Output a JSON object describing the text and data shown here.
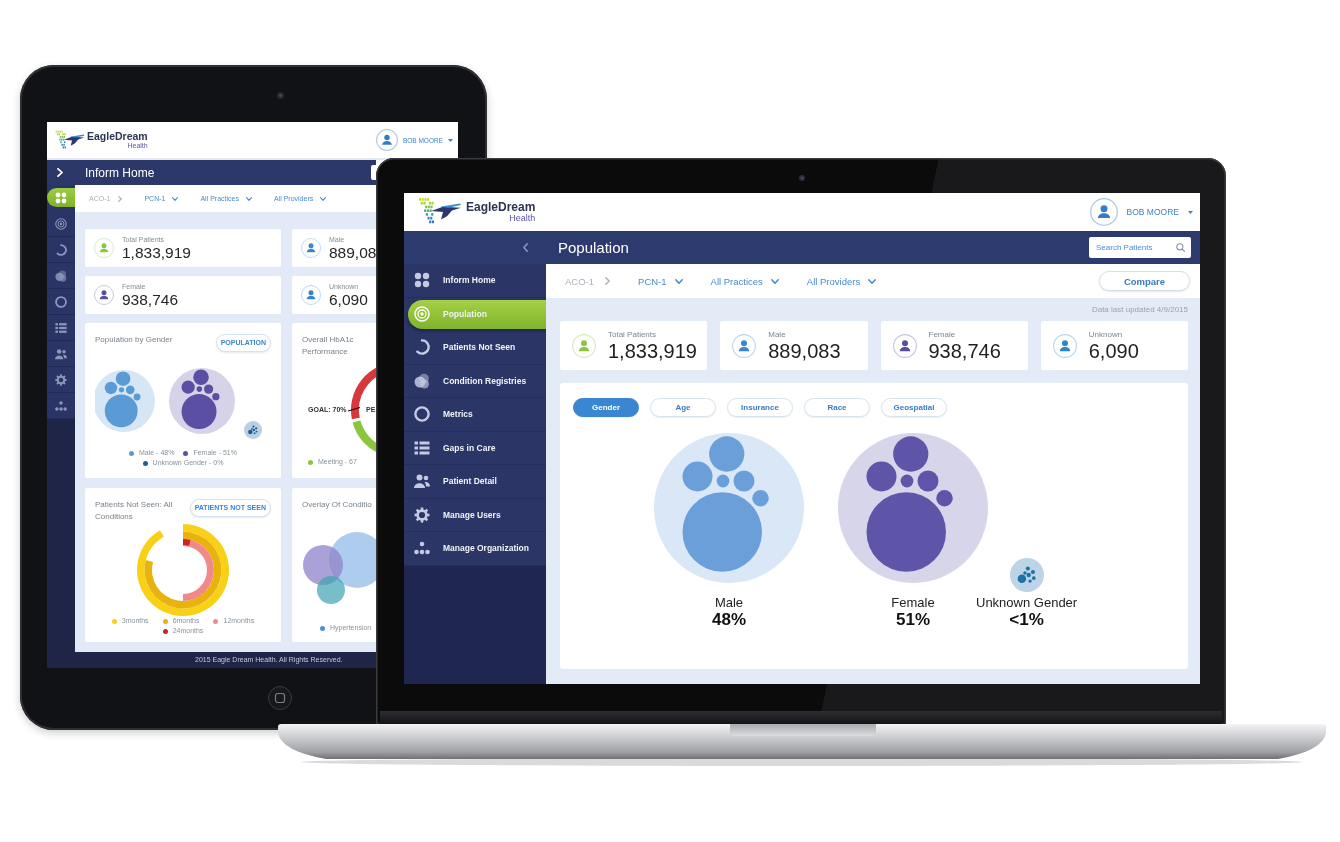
{
  "tablet": {
    "header": {
      "brand": "EagleDream",
      "brand_sub": "Health",
      "user": "BOB MOORE"
    },
    "title_bar": {
      "title": "Inform Home"
    },
    "rail": [
      {
        "selected": true
      },
      {
        "selected": false
      },
      {
        "selected": false
      },
      {
        "selected": false
      },
      {
        "selected": false
      },
      {
        "selected": false
      },
      {
        "selected": false
      },
      {
        "selected": false
      },
      {
        "selected": false
      }
    ],
    "breadcrumb": {
      "root": "ACO-1",
      "filters": [
        "PCN-1",
        "All Practices",
        "All Providers"
      ]
    },
    "stats": [
      {
        "label": "Total Patients",
        "value": "1,833,919",
        "color": "#8cc63f"
      },
      {
        "label": "Male",
        "value": "889,08",
        "color": "#3a86d0"
      },
      {
        "label": "Female",
        "value": "938,746",
        "color": "#5a4fa3"
      },
      {
        "label": "Unknown",
        "value": "6,090",
        "color": "#2f86c9"
      }
    ],
    "cards": [
      {
        "kind": "gender",
        "title": "Population by Gender",
        "button": "POPULATION",
        "legend": [
          {
            "label": "Male - 48%",
            "color": "#5b9bd5"
          },
          {
            "label": "Female - 51%",
            "color": "#5a4fa3"
          },
          {
            "label": "Unknown Gender - 0%",
            "color": "#1d5f96"
          }
        ]
      },
      {
        "kind": "gauge",
        "title": "Overall HbA1c Performance",
        "goal_label": "GOAL: 70%",
        "side_label": "PE",
        "legend": [
          {
            "label": "Meeting - 67",
            "color": "#8cc63f"
          }
        ]
      },
      {
        "kind": "radial",
        "title": "Patients Not Seen: All Conditions",
        "button": "PATIENTS NOT SEEN",
        "legend": [
          {
            "label": "3months",
            "color": "#f8d117"
          },
          {
            "label": "6months",
            "color": "#e8b30c"
          },
          {
            "label": "12months",
            "color": "#f08a8a"
          },
          {
            "label": "24months",
            "color": "#c62828"
          }
        ]
      },
      {
        "kind": "venn",
        "title": "Overlay Of Conditio",
        "legend": [
          {
            "label": "Hypertension",
            "color": "#4a90d9"
          }
        ]
      }
    ],
    "footer": "2015 Eagle Dream Health. All Rights Reserved."
  },
  "laptop": {
    "header": {
      "brand": "EagleDream",
      "brand_sub": "Health",
      "user": "BOB MOORE"
    },
    "title_bar": {
      "title": "Population",
      "search": {
        "placeholder": "Search Patients"
      }
    },
    "sidebar": [
      {
        "label": "Inform Home",
        "selected": false
      },
      {
        "label": "Population",
        "selected": true
      },
      {
        "label": "Patients Not Seen",
        "selected": false
      },
      {
        "label": "Condition Registries",
        "selected": false
      },
      {
        "label": "Metrics",
        "selected": false
      },
      {
        "label": "Gaps in Care",
        "selected": false
      },
      {
        "label": "Patient Detail",
        "selected": false
      },
      {
        "label": "Manage Users",
        "selected": false
      },
      {
        "label": "Manage Organization",
        "selected": false
      }
    ],
    "breadcrumb": {
      "root": "ACO-1",
      "filters": [
        "PCN-1",
        "All Practices",
        "All Providers"
      ]
    },
    "compare_button": "Compare",
    "updated": "Data last updated 4/9/2015",
    "stats": [
      {
        "label": "Total Patients",
        "value": "1,833,919",
        "color": "#8cc63f"
      },
      {
        "label": "Male",
        "value": "889,083",
        "color": "#3a86d0"
      },
      {
        "label": "Female",
        "value": "938,746",
        "color": "#5b4aa8"
      },
      {
        "label": "Unknown",
        "value": "6,090",
        "color": "#2a86cf"
      }
    ],
    "chart_panel": {
      "tabs": [
        {
          "label": "Gender",
          "selected": true
        },
        {
          "label": "Age",
          "selected": false
        },
        {
          "label": "Insurance",
          "selected": false
        },
        {
          "label": "Race",
          "selected": false
        },
        {
          "label": "Geospatial",
          "selected": false
        }
      ],
      "groups": [
        {
          "kind": "bubbles",
          "label": "Male",
          "value": "48%",
          "color": "#6a9fd9"
        },
        {
          "kind": "bubbles",
          "label": "Female",
          "value": "51%",
          "color": "#5e55a9"
        },
        {
          "kind": "dots",
          "label": "Unknown Gender",
          "value": "<1%",
          "color": "#1f6fa8"
        }
      ]
    }
  }
}
